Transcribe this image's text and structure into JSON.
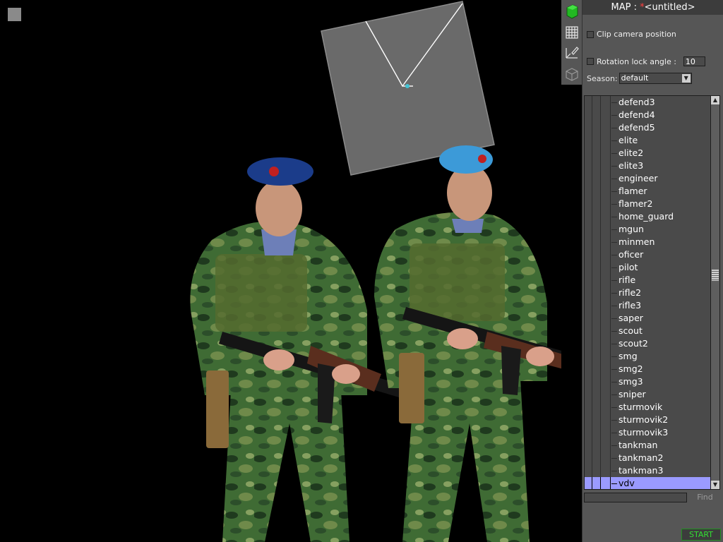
{
  "map_title": {
    "prefix": "MAP : ",
    "modified_marker": "*",
    "name": "<untitled>"
  },
  "options": {
    "clip_camera_label": "Clip camera position",
    "rotation_lock_label": "Rotation lock angle :",
    "rotation_lock_value": "10",
    "season_label": "Season:",
    "season_value": "default"
  },
  "tree": {
    "items": [
      "defend3",
      "defend4",
      "defend5",
      "elite",
      "elite2",
      "elite3",
      "engineer",
      "flamer",
      "flamer2",
      "home_guard",
      "mgun",
      "minmen",
      "oficer",
      "pilot",
      "rifle",
      "rifle2",
      "rifle3",
      "saper",
      "scout",
      "scout2",
      "smg",
      "smg2",
      "smg3",
      "sniper",
      "sturmovik",
      "sturmovik2",
      "sturmovik3",
      "tankman",
      "tankman2",
      "tankman3",
      "vdv"
    ],
    "selected": "vdv"
  },
  "find_label": "Find",
  "start_label": "START",
  "icons": {
    "tool_1": "green-cube-icon",
    "tool_2": "grid-icon",
    "tool_3": "brush-axes-icon",
    "tool_4": "wireframe-cube-icon"
  },
  "colors": {
    "panel": "#565656",
    "selection": "#9a9aff",
    "start_text": "#33e033",
    "modified_marker": "#ff4040"
  }
}
